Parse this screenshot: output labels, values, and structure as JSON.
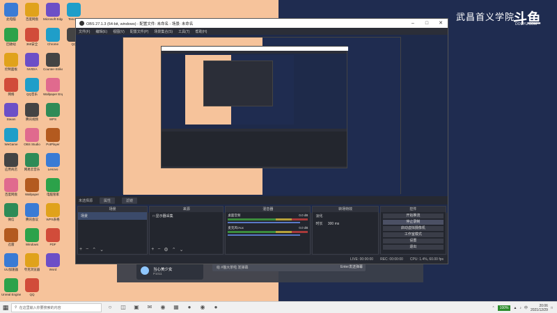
{
  "desktop": {
    "icons_col1": [
      "此电脑",
      "回收站",
      "控制面板",
      "网络",
      "Steam",
      "WeGame",
      "应用商店",
      "百度网盘",
      "微信",
      "迅雷",
      "UU加速器",
      "Unreal Engine"
    ],
    "icons_col2": [
      "百度网盘",
      "360安全",
      "NVIDIA",
      "QQ音乐",
      "腾讯视频",
      "OBS Studio",
      "网易云音乐",
      "Wallpaper",
      "腾讯会议",
      "Windows",
      "夸克浏览器",
      "QQ"
    ],
    "icons_col3": [
      "Microsoft Edge",
      "Chrome",
      "Counter-Strike",
      "Wallpaper Engine",
      "WPS",
      "PotPlayer",
      "Lenovo",
      "电脑管家",
      "WPS表格",
      "PDF",
      "Word"
    ],
    "icons_col4": [
      "Tencent",
      "QQ"
    ],
    "watermark": "武昌首义学院",
    "watermark_logo": "斗鱼",
    "watermark_sub": "DOUYU.COM"
  },
  "obs": {
    "title": "OBS 27.1.3 (64-bit, windows) - 配置文件: 未命名 - 场景: 未命名",
    "menu": [
      "文件(F)",
      "编辑(E)",
      "视图(V)",
      "配置文件(P)",
      "场景集合(S)",
      "工具(T)",
      "帮助(H)"
    ],
    "source_toolbar": {
      "label": "未选择源",
      "properties": "属性",
      "filters": "滤镜"
    },
    "docks": {
      "scenes": {
        "title": "场景",
        "items": [
          "场景"
        ]
      },
      "sources": {
        "title": "来源",
        "items": [
          "显示器采集"
        ]
      },
      "mixer": {
        "title": "混音器",
        "channels": [
          {
            "name": "桌面音频",
            "db": "0.0 dB"
          },
          {
            "name": "麦克风/Aux",
            "db": "0.0 dB"
          }
        ]
      },
      "transitions": {
        "title": "转场特效",
        "type": "淡化",
        "duration_label": "时长",
        "duration_value": "300 ms"
      },
      "controls": {
        "title": "控件",
        "buttons": [
          "开始推流",
          "停止录制",
          "启动虚拟摄像机",
          "工作室模式",
          "设置",
          "退出"
        ]
      }
    },
    "status": {
      "live": "LIVE: 00:00:00",
      "rec": "REC: 00:00:00",
      "cpu": "CPU: 1.4%, 60.00 fps"
    }
  },
  "overlay": {
    "anchor_name": "当心美少女",
    "anchor_id": "P1011",
    "chat_placeholder": "给 #猫大茶啦 发弹幕",
    "send_label": "Enter发送弹幕"
  },
  "taskbar": {
    "search_placeholder": "在这里输入你要搜索的内容",
    "battery": "100%",
    "time": "20:06",
    "date": "2021/12/29"
  }
}
